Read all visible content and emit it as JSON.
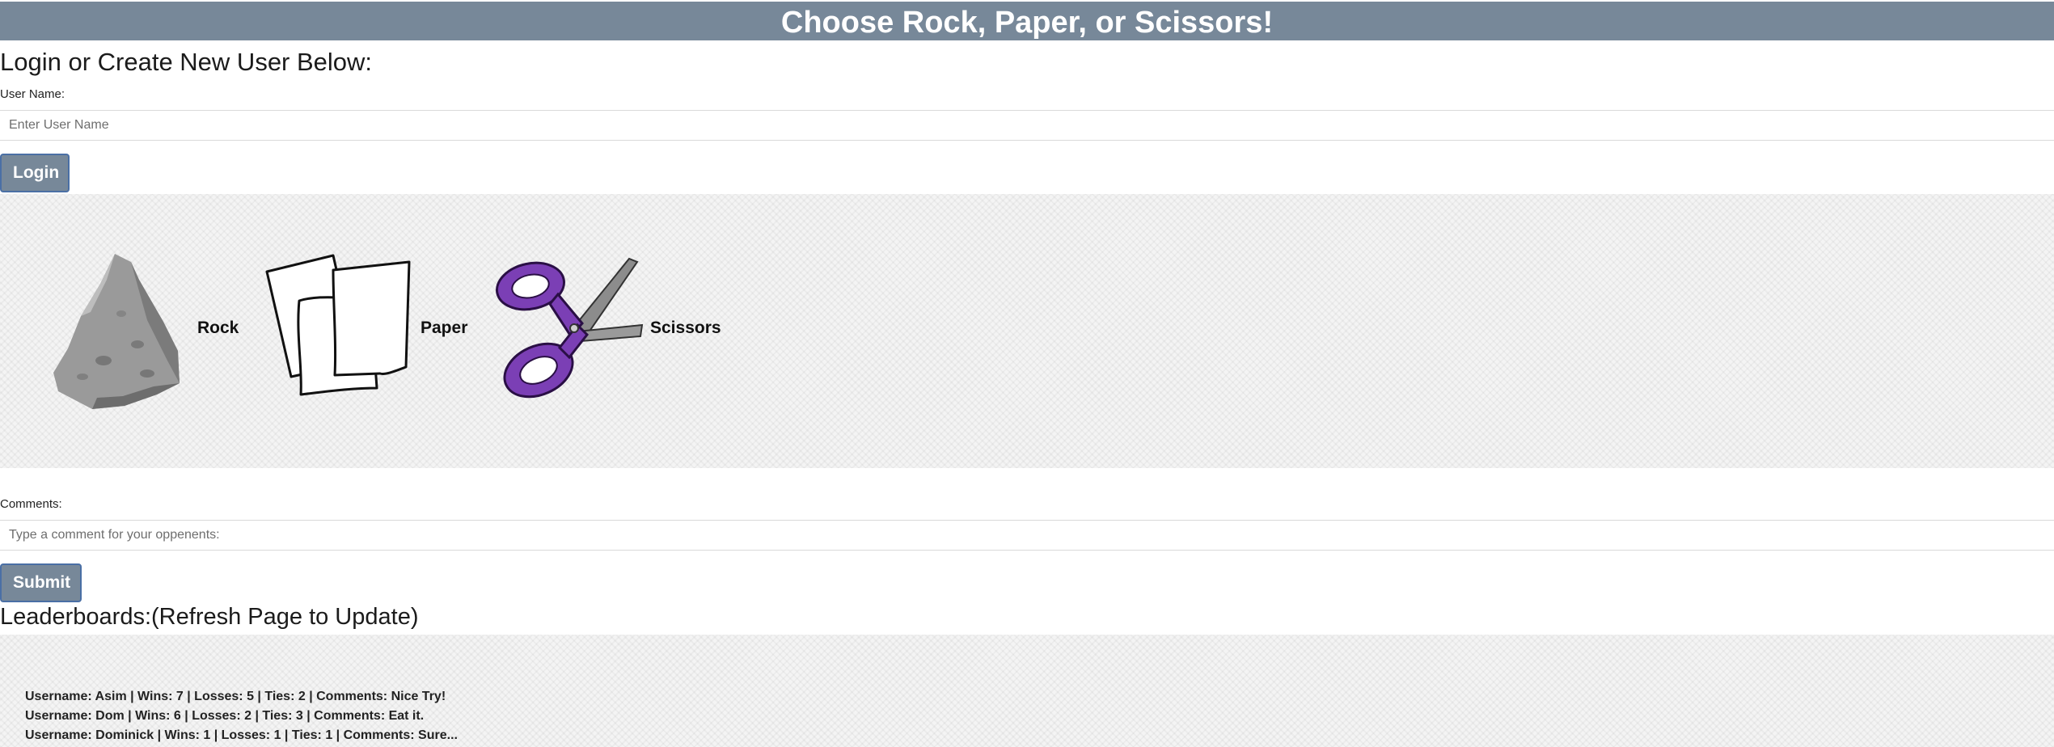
{
  "header": {
    "title": "Choose Rock, Paper, or Scissors!"
  },
  "login": {
    "heading": "Login or Create New User Below:",
    "username_label": "User Name:",
    "username_placeholder": "Enter User Name",
    "button": "Login"
  },
  "choices": [
    {
      "label": "Rock",
      "icon": "rock-icon"
    },
    {
      "label": "Paper",
      "icon": "paper-icon"
    },
    {
      "label": "Scissors",
      "icon": "scissors-icon"
    }
  ],
  "comments": {
    "label": "Comments:",
    "placeholder": "Type a comment for your oppenents:",
    "button": "Submit"
  },
  "leaderboard": {
    "heading": "Leaderboards:(Refresh Page to Update)",
    "rows": [
      "Username: Asim | Wins: 7 | Losses: 5 | Ties: 2 | Comments: Nice Try!",
      "Username: Dom | Wins: 6 | Losses: 2 | Ties: 3 | Comments: Eat it.",
      "Username: Dominick | Wins: 1 | Losses: 1 | Ties: 1 | Comments: Sure..."
    ]
  },
  "colors": {
    "banner": "#778899",
    "button": "#778899",
    "button_border": "#4a6fa5",
    "scissors_handle": "#7b3fb5"
  }
}
